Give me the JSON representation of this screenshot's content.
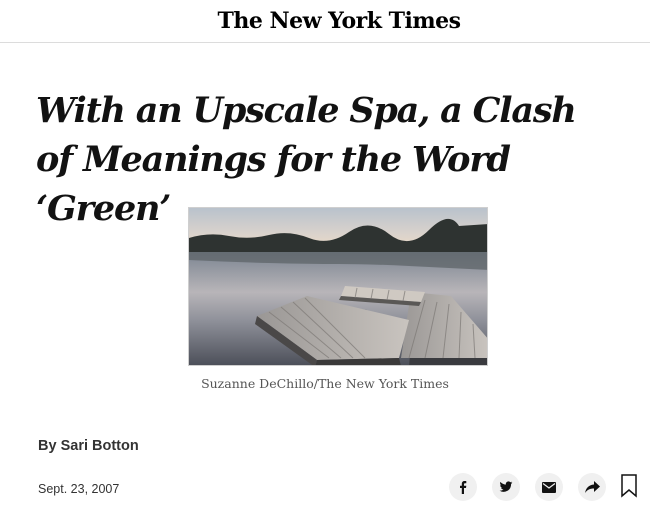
{
  "masthead": {
    "logo_text": "The New York Times"
  },
  "article": {
    "headline": "With an Upscale Spa, a Clash of Meanings for the Word ‘Green’",
    "image_caption": "Suzanne DeChillo/The New York Times",
    "byline_prefix": "By ",
    "author": "Sari Botton",
    "date": "Sept. 23, 2007"
  },
  "share_tools": [
    {
      "name": "facebook-icon"
    },
    {
      "name": "twitter-icon"
    },
    {
      "name": "email-icon"
    },
    {
      "name": "share-icon"
    },
    {
      "name": "bookmark-icon"
    }
  ],
  "colors": {
    "text": "#121212",
    "meta": "#333333",
    "caption": "#555555",
    "button_bg": "#f0f0f0"
  }
}
